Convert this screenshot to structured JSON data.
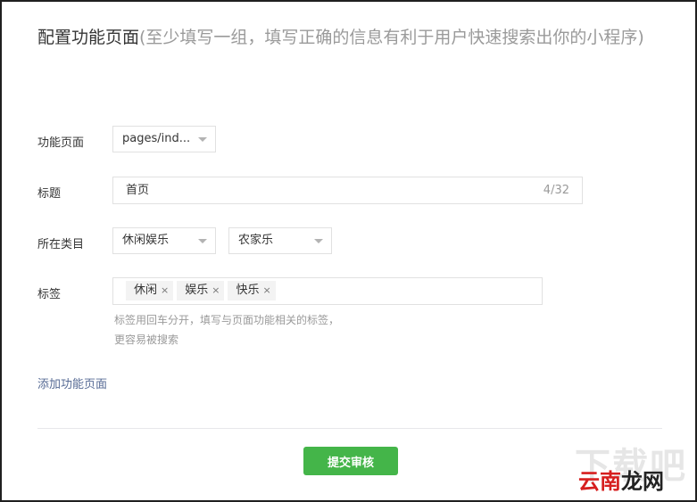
{
  "header": {
    "title": "配置功能页面",
    "subtitle": "(至少填写一组，填写正确的信息有利于用户快速搜索出你的小程序)"
  },
  "form": {
    "page_label": "功能页面",
    "page_value": "pages/ind...",
    "title_label": "标题",
    "title_value": "首页",
    "title_counter": "4/32",
    "category_label": "所在类目",
    "category_primary": "休闲娱乐",
    "category_secondary": "农家乐",
    "tags_label": "标签",
    "tags": [
      {
        "text": "休闲",
        "remove": "×"
      },
      {
        "text": "娱乐",
        "remove": "×"
      },
      {
        "text": "快乐",
        "remove": "×"
      }
    ],
    "tags_hint_line1": "标签用回车分开，填写与页面功能相关的标签，",
    "tags_hint_line2": "更容易被搜索"
  },
  "actions": {
    "add_page_link": "添加功能页面",
    "submit_label": "提交审核"
  },
  "watermark": {
    "big": "下载吧",
    "small_red": "云南",
    "small_dark": "龙网"
  },
  "colors": {
    "accent_green": "#44b549",
    "link_blue": "#576b95",
    "muted_text": "#9a9a9a"
  }
}
